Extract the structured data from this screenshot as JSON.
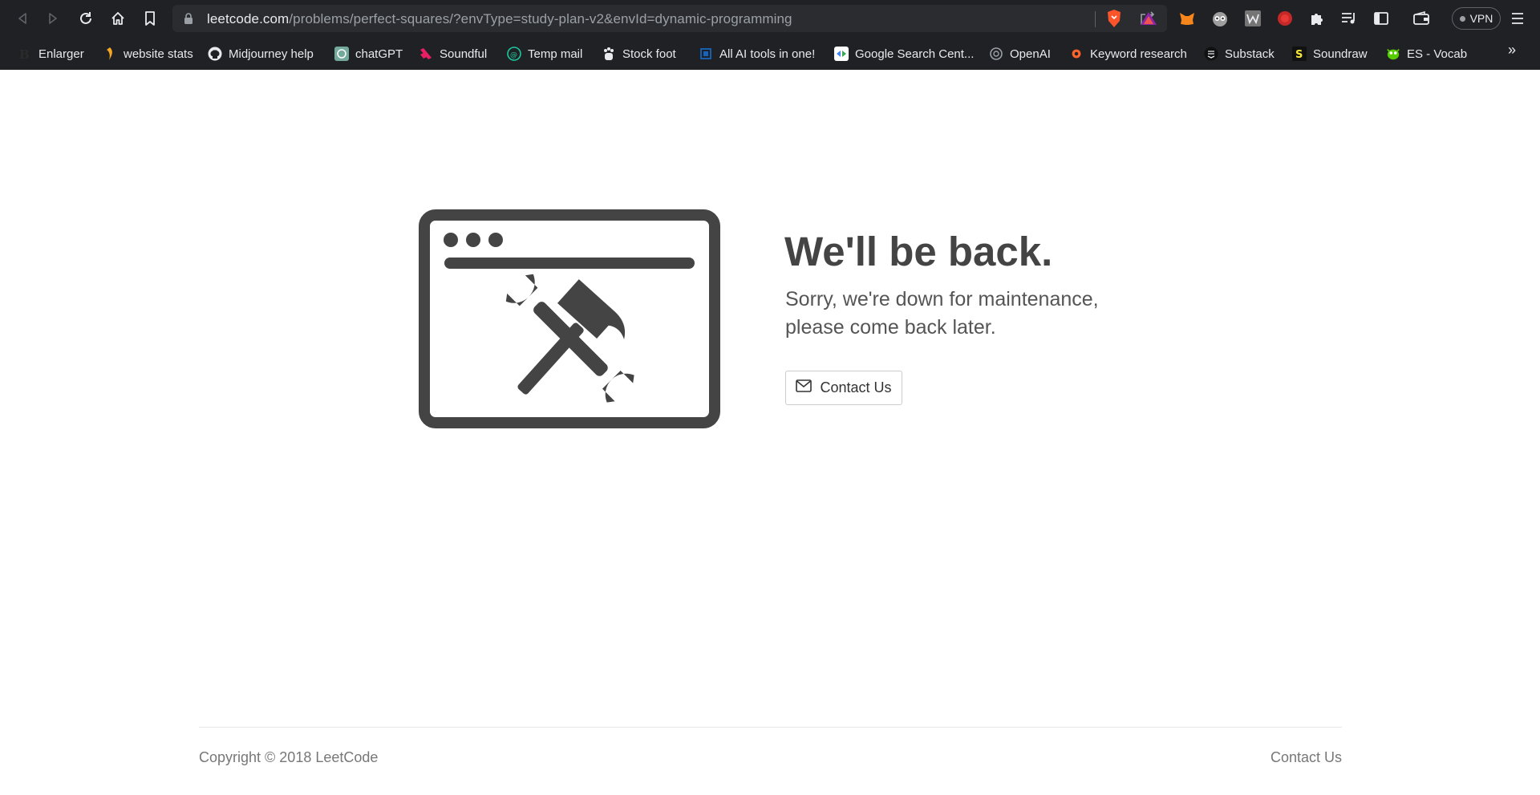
{
  "browser": {
    "url_host": "leetcode.com",
    "url_path": "/problems/perfect-squares/?envType=study-plan-v2&envId=dynamic-programming",
    "nav_icons": [
      "back-icon",
      "forward-icon",
      "reload-icon",
      "home-icon",
      "bookmark-icon"
    ],
    "vpn_label": "VPN",
    "bookmarks": [
      {
        "label": "Enlarger",
        "icon": "enlarger-favicon"
      },
      {
        "label": "website stats",
        "icon": "website-stats-favicon"
      },
      {
        "label": "Midjourney help",
        "icon": "github-favicon"
      },
      {
        "label": "chatGPT",
        "icon": "chatgpt-favicon"
      },
      {
        "label": "Soundful",
        "icon": "soundful-favicon"
      },
      {
        "label": "Temp mail",
        "icon": "temp-mail-favicon"
      },
      {
        "label": "Stock foot",
        "icon": "stock-foot-favicon"
      },
      {
        "label": "All AI tools in one!",
        "icon": "ai-tools-favicon"
      },
      {
        "label": "Google Search Cent...",
        "icon": "google-search-central-favicon"
      },
      {
        "label": "OpenAI",
        "icon": "openai-favicon"
      },
      {
        "label": "Keyword research",
        "icon": "keyword-research-favicon"
      },
      {
        "label": "Substack",
        "icon": "substack-favicon"
      },
      {
        "label": "Soundraw",
        "icon": "soundraw-favicon"
      },
      {
        "label": "ES - Vocab",
        "icon": "es-vocab-favicon"
      }
    ],
    "more_bookmarks": "»"
  },
  "page": {
    "headline": "We'll be back.",
    "subtext": "Sorry, we're down for maintenance, please come back later.",
    "contact_button": "Contact Us",
    "footer_copyright": "Copyright © 2018 LeetCode",
    "footer_contact": "Contact Us"
  },
  "colors": {
    "chrome_bg": "#202124",
    "omnibox_bg": "#2b2c30",
    "illustration": "#444444",
    "heading": "#444444",
    "footer_text": "#777777"
  }
}
